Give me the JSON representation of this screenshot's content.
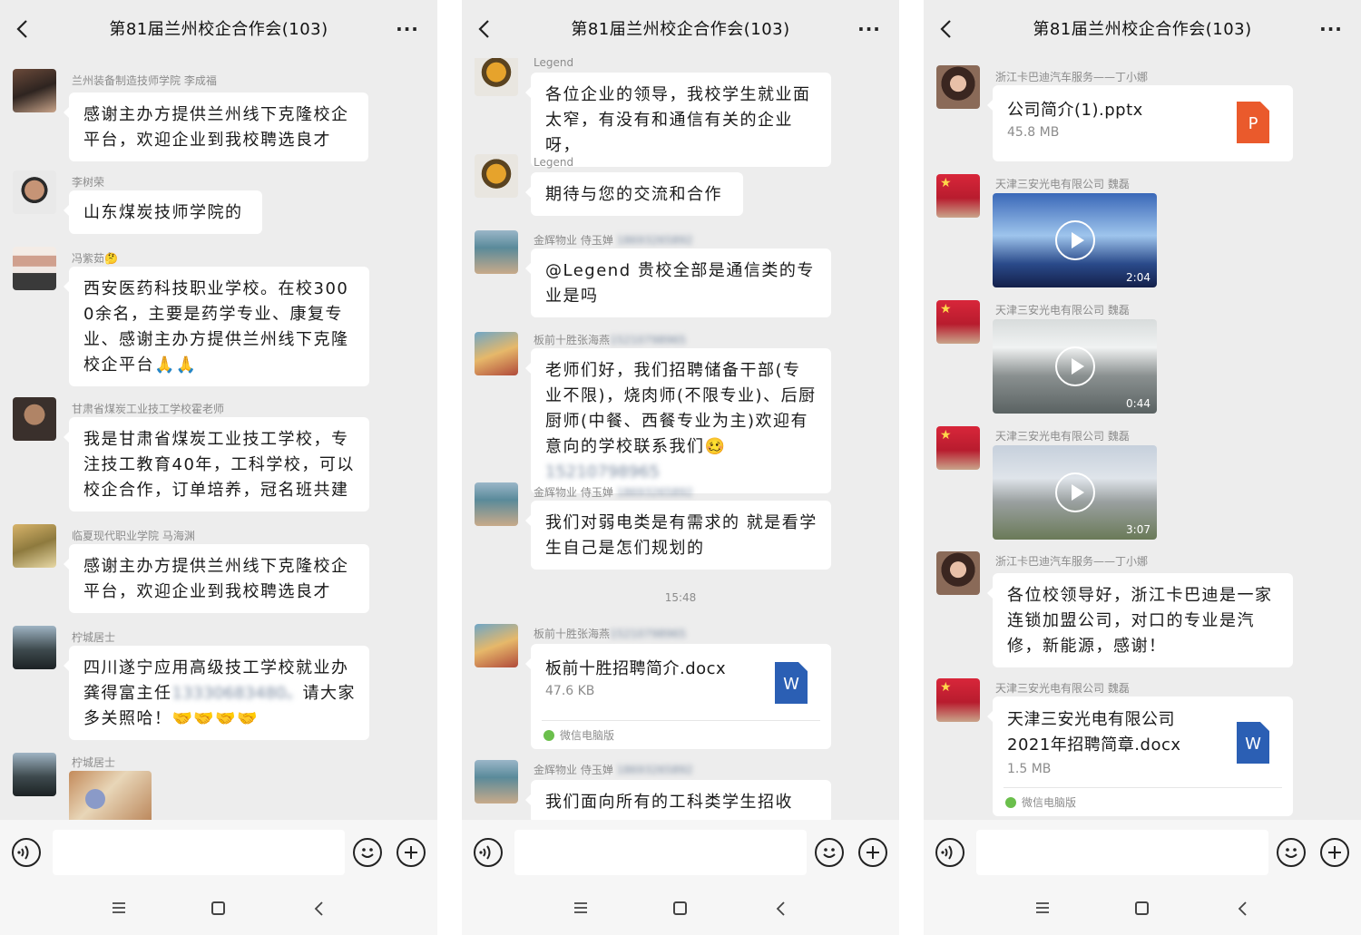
{
  "chat_title": "第81届兰州校企合作会(103)",
  "more_label": "···",
  "panel1": {
    "messages": [
      {
        "sender": "兰州装备制造技师学院 李成福",
        "text": "感谢主办方提供兰州线下克隆校企平台，欢迎企业到我校聘选良才"
      },
      {
        "sender": "李树荣",
        "text": "山东煤炭技师学院的"
      },
      {
        "sender": "冯紫茹🤔",
        "text": "西安医药科技职业学校。在校3000余名，主要是药学专业、康复专业、感谢主办方提供兰州线下克隆校企平台🙏🙏"
      },
      {
        "sender": "甘肃省煤炭工业技工学校霍老师",
        "text": "我是甘肃省煤炭工业技工学校，专注技工教育40年，工科学校，可以校企合作，订单培养，冠名班共建"
      },
      {
        "sender": "临夏现代职业学院 马海渊",
        "text": "感谢主办方提供兰州线下克隆校企平台，欢迎企业到我校聘选良才"
      },
      {
        "sender": "柠城居士",
        "text_before": "四川遂宁应用高级技工学校就业办龚得富主任",
        "redacted": "13330683480。",
        "text_after": "请大家多关照哈！🤝🤝🤝🤝"
      },
      {
        "sender": "柠城居士"
      }
    ]
  },
  "panel2": {
    "messages": [
      {
        "sender": "Legend",
        "text": "各位企业的领导，我校学生就业面太窄，有没有和通信有关的企业呀，"
      },
      {
        "sender": "Legend",
        "text": "期待与您的交流和合作"
      },
      {
        "sender": "金辉物业 侍玉婵",
        "sender_redacted": "18693265892",
        "text": "@Legend 贵校全部是通信类的专业是吗"
      },
      {
        "sender": "板前十胜张海燕",
        "sender_redacted": "15210798965",
        "text_before": "老师们好，我们招聘储备干部(专业不限)，烧肉师(不限专业)、后厨厨师(中餐、西餐专业为主)欢迎有意向的学校联系我们🥴",
        "redacted": "15210798965"
      },
      {
        "sender": "金辉物业 侍玉婵",
        "sender_redacted": "18693265892",
        "text": "我们对弱电类是有需求的 就是看学生自己是怎们规划的"
      },
      {
        "timestamp": "15:48"
      },
      {
        "sender": "板前十胜张海燕",
        "sender_redacted": "15210798965",
        "file": {
          "name": "板前十胜招聘简介.docx",
          "size": "47.6 KB",
          "icon_letter": "W",
          "source": "微信电脑版"
        }
      },
      {
        "sender": "金辉物业 侍玉婵",
        "sender_redacted": "18693265892",
        "text": "我们面向所有的工科类学生招收"
      }
    ]
  },
  "panel3": {
    "messages": [
      {
        "sender": "浙江卡巴迪汽车服务——丁小娜",
        "file": {
          "name": "公司简介(1).pptx",
          "size": "45.8 MB",
          "icon_letter": "P"
        }
      },
      {
        "sender": "天津三安光电有限公司 魏磊",
        "video": {
          "duration": "2:04"
        }
      },
      {
        "sender": "天津三安光电有限公司 魏磊",
        "video": {
          "duration": "0:44"
        }
      },
      {
        "sender": "天津三安光电有限公司 魏磊",
        "video": {
          "duration": "3:07"
        }
      },
      {
        "sender": "浙江卡巴迪汽车服务——丁小娜",
        "text": "各位校领导好，浙江卡巴迪是一家连锁加盟公司，对口的专业是汽修，新能源，感谢！"
      },
      {
        "sender": "天津三安光电有限公司 魏磊",
        "file": {
          "name_line1": "天津三安光电有限公司",
          "name_line2": "2021年招聘简章.docx",
          "size": "1.5 MB",
          "icon_letter": "W",
          "source": "微信电脑版"
        }
      }
    ]
  },
  "colors": {
    "background": "#ededed",
    "bubble": "#ffffff",
    "word_icon": "#2b5fb4",
    "ppt_icon": "#ea5a2c"
  }
}
